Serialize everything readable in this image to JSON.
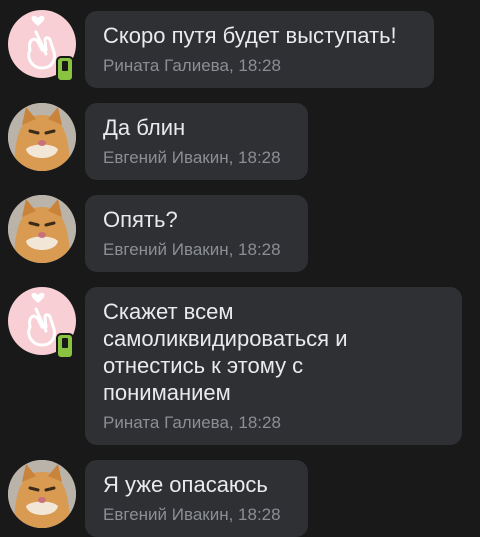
{
  "messages": [
    {
      "author": "Рината Галиева",
      "time": "18:28",
      "meta": "Рината Галиева, 18:28",
      "text": "Скоро путя будет выступать!",
      "avatar_icon": "hand-heart-icon",
      "online_mobile": true
    },
    {
      "author": "Евгений Ивакин",
      "time": "18:28",
      "meta": "Евгений Ивакин, 18:28",
      "text": "Да блин",
      "avatar_icon": "cat-photo",
      "online_mobile": false
    },
    {
      "author": "Евгений Ивакин",
      "time": "18:28",
      "meta": "Евгений Ивакин, 18:28",
      "text": "Опять?",
      "avatar_icon": "cat-photo",
      "online_mobile": false
    },
    {
      "author": "Рината Галиева",
      "time": "18:28",
      "meta": "Рината Галиева, 18:28",
      "text": "Скажет всем\nсамоликвидироваться и\nотнестись к этому с\nпониманием",
      "avatar_icon": "hand-heart-icon",
      "online_mobile": true
    },
    {
      "author": "Евгений Ивакин",
      "time": "18:28",
      "meta": "Евгений Ивакин, 18:28",
      "text": "Я уже опасаюсь",
      "avatar_icon": "cat-photo",
      "online_mobile": false
    }
  ],
  "colors": {
    "background": "#19191a",
    "bubble": "#2f3034",
    "text": "#e9eaed",
    "meta": "#8b8e95",
    "online_badge": "#8ac340"
  }
}
